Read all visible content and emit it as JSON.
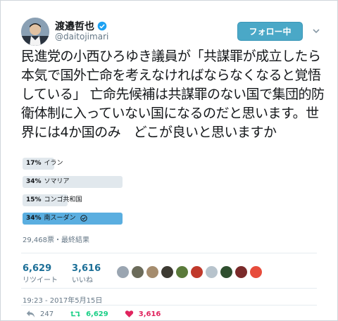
{
  "user": {
    "name": "渡邉哲也",
    "handle": "@daitojimari",
    "follow_label": "フォロー中"
  },
  "tweet": {
    "text": "民進党の小西ひろゆき議員が「共謀罪が成立したら本気で国外亡命を考えなければならなくなると覚悟している」 亡命先候補は共謀罪のない国で集団的防衛体制に入っていない国になるのだと思います。世界には4か国のみ　どこが良いと思いますか"
  },
  "poll": {
    "options": [
      {
        "percent": "17%",
        "label": "イラン",
        "fraction": 0.17,
        "winner": false
      },
      {
        "percent": "34%",
        "label": "ソマリア",
        "fraction": 0.34,
        "winner": false
      },
      {
        "percent": "15%",
        "label": "コンゴ共和国",
        "fraction": 0.15,
        "winner": false
      },
      {
        "percent": "34%",
        "label": "南スーダン",
        "fraction": 0.34,
        "winner": true
      }
    ],
    "meta": "29,468票・最終結果"
  },
  "stats": {
    "retweets": {
      "count": "6,629",
      "label": "リツイート"
    },
    "likes": {
      "count": "3,616",
      "label": "いいね"
    }
  },
  "timestamp": "19:23 - 2017年5月15日",
  "actions": {
    "reply_count": "247",
    "retweet_count": "6,629",
    "like_count": "3,616"
  },
  "colors": {
    "accent": "#1da1f2",
    "follow_bg": "#4aa8c7",
    "retweet": "#19cf86",
    "like": "#e0245e"
  }
}
